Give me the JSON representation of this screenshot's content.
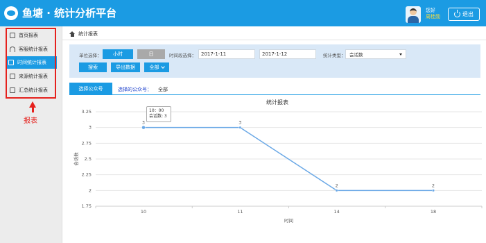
{
  "header": {
    "app_title": "鱼塘 · 统计分析平台",
    "greeting": "您好",
    "user_name": "周桂勋",
    "logout_label": "退出"
  },
  "sidebar": {
    "items": [
      {
        "label": "首页报表",
        "icon": "home-icon",
        "active": false
      },
      {
        "label": "客服统计报表",
        "icon": "headset-icon",
        "active": false
      },
      {
        "label": "时间统计报表",
        "icon": "calendar-check-icon",
        "active": true
      },
      {
        "label": "来源统计报表",
        "icon": "calendar-icon",
        "active": false
      },
      {
        "label": "汇总统计报表",
        "icon": "clipboard-icon",
        "active": false
      }
    ],
    "annotation_label": "报表"
  },
  "breadcrumb": {
    "label": "统计报表"
  },
  "filters": {
    "unit_label": "单位选择：",
    "unit_hour": "小时",
    "unit_day": "日",
    "period_label": "时间段选择：",
    "start_date": "2017-1-11",
    "end_date": "2017-1-12",
    "stat_type_label": "统计类型：",
    "stat_type_value": "会话数",
    "search_button": "搜索",
    "export_button": "导出数据",
    "all_button": "全部"
  },
  "account": {
    "select_button": "选择公众号",
    "selected_label": "选择的公众号：",
    "selected_value": "全部"
  },
  "tooltip": {
    "time": "10：00",
    "value_text": "会话数: 3"
  },
  "chart_data": {
    "type": "line",
    "title": "统计报表",
    "xlabel": "时间",
    "ylabel": "会话数",
    "x_ticks": [
      "10",
      "11",
      "14",
      "18"
    ],
    "y_ticks": [
      "3.25",
      "3",
      "2.75",
      "2.5",
      "2.25",
      "2",
      "1.75"
    ],
    "ylim": [
      1.75,
      3.25
    ],
    "series": [
      {
        "values": [
          3,
          3,
          2,
          2
        ],
        "labels": [
          "3",
          "3",
          "2",
          "2"
        ]
      }
    ],
    "line_color": "#6aa8e6",
    "grid": true
  }
}
